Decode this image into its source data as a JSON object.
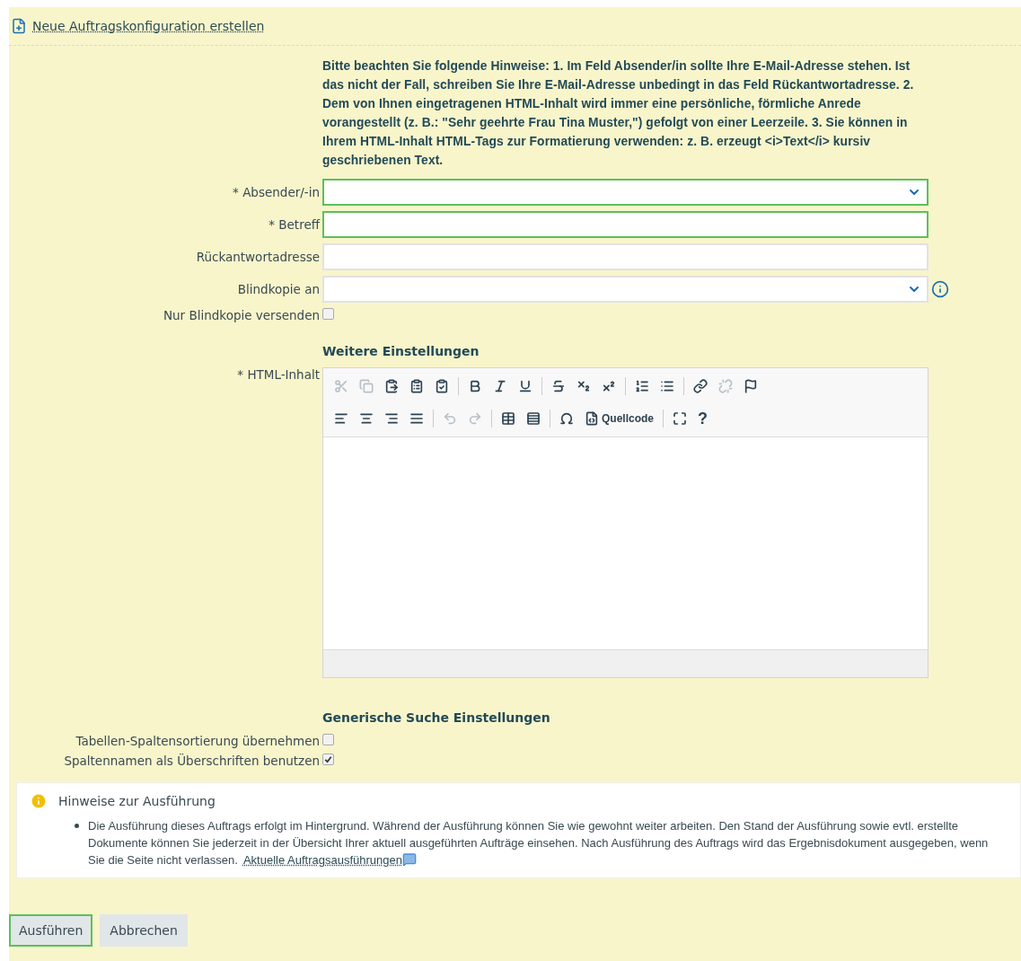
{
  "header_link": "Neue Auftragskonfiguration erstellen",
  "notice": "Bitte beachten Sie folgende Hinweise: 1. Im Feld Absender/in sollte Ihre E-Mail-Adresse stehen. Ist das nicht der Fall, schreiben Sie Ihre E-Mail-Adresse unbedingt in das Feld Rückantwortadresse. 2. Dem von Ihnen eingetragenen HTML-Inhalt wird immer eine persönliche, förmliche Anrede vorangestellt (z. B.: \"Sehr geehrte Frau Tina Muster,\") gefolgt von einer Leerzeile. 3. Sie können in Ihrem HTML-Inhalt HTML-Tags zur Formatierung verwenden: z. B. erzeugt <i>Text</i> kursiv geschriebenen Text.",
  "fields": [
    {
      "kind": "select",
      "label": "* Absender/-in",
      "highlighted": true
    },
    {
      "kind": "text",
      "label": "* Betreff",
      "highlighted": true
    },
    {
      "kind": "text",
      "label": "Rückantwortadresse",
      "highlighted": false
    },
    {
      "kind": "select",
      "label": "Blindkopie an",
      "highlighted": false,
      "info": true
    },
    {
      "kind": "checkbox",
      "label": "Nur Blindkopie versenden",
      "checked": false
    }
  ],
  "section_title": "Weitere Einstellungen",
  "editor": {
    "label": "* HTML-Inhalt",
    "toolbar": [
      [
        {
          "kind": "button",
          "disabled": true
        },
        {
          "kind": "button",
          "disabled": true
        },
        {
          "kind": "button",
          "disabled": false
        },
        {
          "kind": "button",
          "disabled": false
        },
        {
          "kind": "button",
          "disabled": false
        },
        {
          "kind": "separator"
        },
        {
          "kind": "button",
          "disabled": false
        },
        {
          "kind": "button",
          "disabled": false
        },
        {
          "kind": "button",
          "disabled": false
        },
        {
          "kind": "separator"
        },
        {
          "kind": "button",
          "disabled": false
        },
        {
          "kind": "button",
          "disabled": false
        },
        {
          "kind": "button",
          "disabled": false
        },
        {
          "kind": "separator"
        },
        {
          "kind": "button",
          "disabled": false
        },
        {
          "kind": "button",
          "disabled": false
        },
        {
          "kind": "separator"
        },
        {
          "kind": "button",
          "disabled": false
        },
        {
          "kind": "button",
          "disabled": true
        },
        {
          "kind": "button",
          "disabled": false
        }
      ],
      [
        {
          "kind": "button",
          "disabled": false
        },
        {
          "kind": "button",
          "disabled": false
        },
        {
          "kind": "button",
          "disabled": false
        },
        {
          "kind": "button",
          "disabled": false
        },
        {
          "kind": "separator"
        },
        {
          "kind": "button",
          "disabled": true
        },
        {
          "kind": "button",
          "disabled": true
        },
        {
          "kind": "separator"
        },
        {
          "kind": "button",
          "disabled": false
        },
        {
          "kind": "button",
          "disabled": false
        },
        {
          "kind": "separator"
        },
        {
          "kind": "button",
          "disabled": false
        },
        {
          "kind": "button",
          "disabled": false,
          "label": "Quellcode"
        },
        {
          "kind": "separator"
        },
        {
          "kind": "button",
          "disabled": false
        },
        {
          "kind": "button",
          "disabled": false,
          "label": "?"
        }
      ]
    ]
  },
  "section2_title": "Generische Suche Einstellungen",
  "options": [
    {
      "label": "Tabellen-Spaltensortierung übernehmen",
      "checked": false
    },
    {
      "label": "Spaltennamen als Überschriften benutzen",
      "checked": true
    }
  ],
  "info_box": {
    "title": "Hinweise zur Ausführung",
    "text": "Die Ausführung dieses Auftrags erfolgt im Hintergrund. Während der Ausführung können Sie wie gewohnt weiter arbeiten. Den Stand der Ausführung sowie evtl. erstellte Dokumente können Sie jederzeit in der Übersicht Ihrer aktuell ausgeführten Aufträge einsehen. Nach Ausführung des Auftrags wird das Ergebnisdokument ausgegeben, wenn Sie die Seite nicht verlassen.",
    "link": "Aktuelle Auftragsausführungen"
  },
  "buttons": [
    {
      "label": "Ausführen",
      "highlighted": true
    },
    {
      "label": "Abbrechen",
      "highlighted": false
    }
  ]
}
